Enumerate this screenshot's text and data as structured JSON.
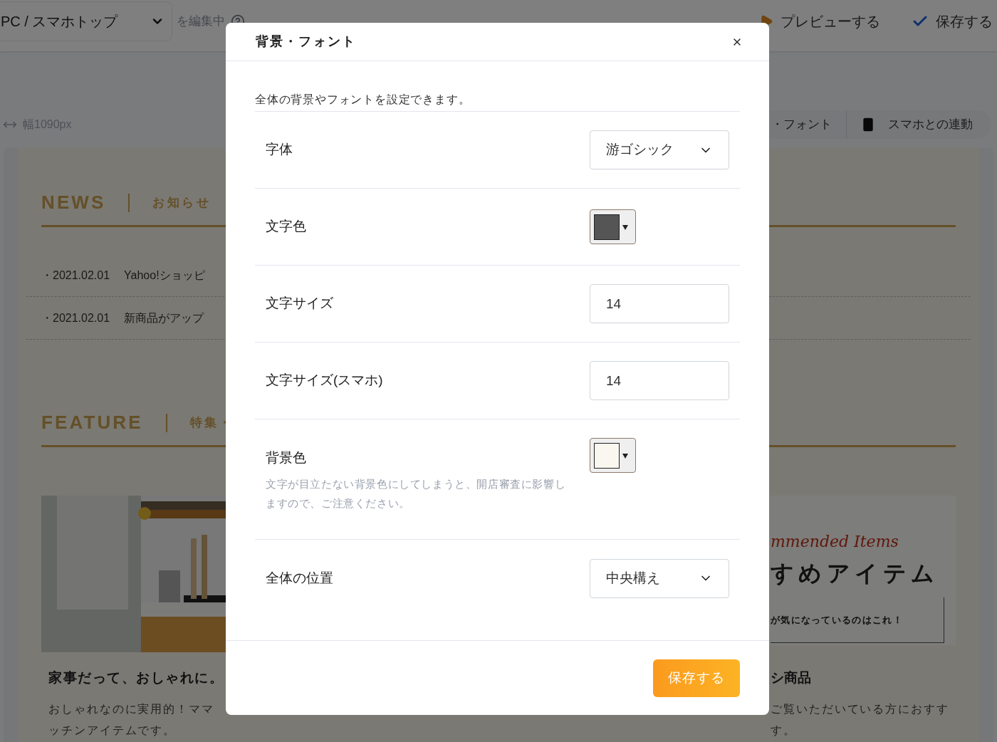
{
  "topbar": {
    "page_select": "PC / スマホトップ",
    "editing_label": "を編集中",
    "preview_button": "プレビューする",
    "save_button": "保存する"
  },
  "toolbar": {
    "width_label": "幅1090px",
    "tabs": [
      {
        "label": "・フォント",
        "kind": "text"
      },
      {
        "label": "スマホとの連動",
        "kind": "phone"
      }
    ]
  },
  "page": {
    "news": {
      "heading": "NEWS",
      "subheading": "お知らせ",
      "items": [
        {
          "date": "・2021.02.01",
          "title": "Yahoo!ショッピ"
        },
        {
          "date": "・2021.02.01",
          "title": "新商品がアップ"
        }
      ]
    },
    "feature": {
      "heading": "FEATURE",
      "subheading": "特集・"
    },
    "cards": [
      {
        "kind": "picture",
        "title": "家事だって、おしゃれに。",
        "lines": [
          "おしゃれなのに実用的！ママ",
          "ッチンアイテムです。"
        ]
      },
      {
        "kind": "recommended",
        "script": "mmended Items",
        "heading": "すめアイテム",
        "note": "が気になっているのはこれ！",
        "title": "シ商品",
        "lines": [
          "ご覧いただいている方におすす",
          "す。"
        ]
      }
    ]
  },
  "modal": {
    "title": "背景・フォント",
    "description": "全体の背景やフォントを設定できます。",
    "rows": [
      {
        "kind": "select",
        "label": "字体",
        "value": "游ゴシック"
      },
      {
        "kind": "color",
        "label": "文字色",
        "color": "#555555"
      },
      {
        "kind": "number",
        "label": "文字サイズ",
        "value": "14"
      },
      {
        "kind": "number",
        "label": "文字サイズ(スマホ)",
        "value": "14"
      },
      {
        "kind": "color",
        "label": "背景色",
        "note": "文字が目立たない背景色にしてしまうと、開店審査に影響しますので、ご注意ください。",
        "color": "#faf7f0"
      },
      {
        "kind": "select",
        "label": "全体の位置",
        "value": "中央構え"
      }
    ],
    "save_button": "保存する"
  }
}
